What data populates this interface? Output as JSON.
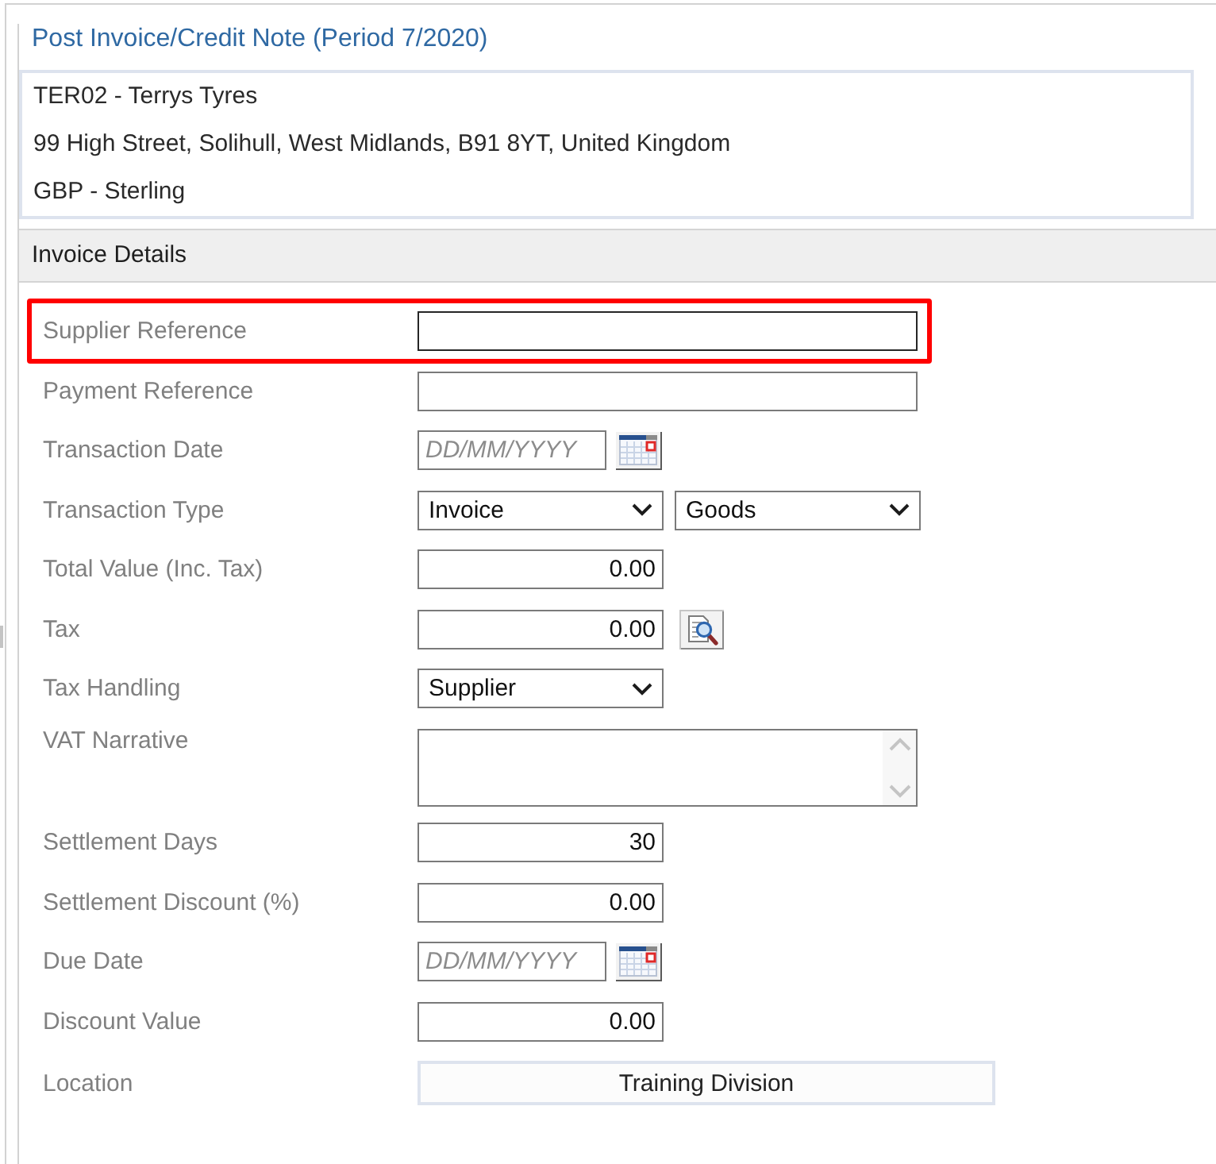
{
  "title": "Post Invoice/Credit Note (Period 7/2020)",
  "supplier_lines": [
    "TER02 - Terrys Tyres",
    "99 High Street, Solihull, West Midlands, B91 8YT, United Kingdom",
    "GBP - Sterling"
  ],
  "section_title": "Invoice Details",
  "fields": [
    {
      "label": "Supplier Reference",
      "kind": "text",
      "highlighted": true
    },
    {
      "label": "Payment Reference",
      "kind": "text",
      "highlighted": false
    },
    {
      "label": "Transaction Date",
      "kind": "date",
      "placeholder": "DD/MM/YYYY",
      "highlighted": false
    },
    {
      "label": "Transaction Type",
      "kind": "selects",
      "values": [
        "Invoice",
        "Goods"
      ],
      "highlighted": false
    },
    {
      "label": "Total Value (Inc. Tax)",
      "kind": "number",
      "value": "0.00",
      "highlighted": false
    },
    {
      "label": "Tax",
      "kind": "number-lookup",
      "value": "0.00",
      "highlighted": false
    },
    {
      "label": "Tax Handling",
      "kind": "select",
      "value": "Supplier",
      "highlighted": false
    },
    {
      "label": "VAT Narrative",
      "kind": "textarea",
      "highlighted": false
    },
    {
      "label": "Settlement Days",
      "kind": "number",
      "value": "30",
      "highlighted": false
    },
    {
      "label": "Settlement Discount (%)",
      "kind": "number",
      "value": "0.00",
      "highlighted": false
    },
    {
      "label": "Due Date",
      "kind": "date",
      "placeholder": "DD/MM/YYYY",
      "highlighted": false
    },
    {
      "label": "Discount Value",
      "kind": "number",
      "value": "0.00",
      "highlighted": false
    },
    {
      "label": "Location",
      "kind": "button",
      "value": "Training Division",
      "highlighted": false
    }
  ]
}
